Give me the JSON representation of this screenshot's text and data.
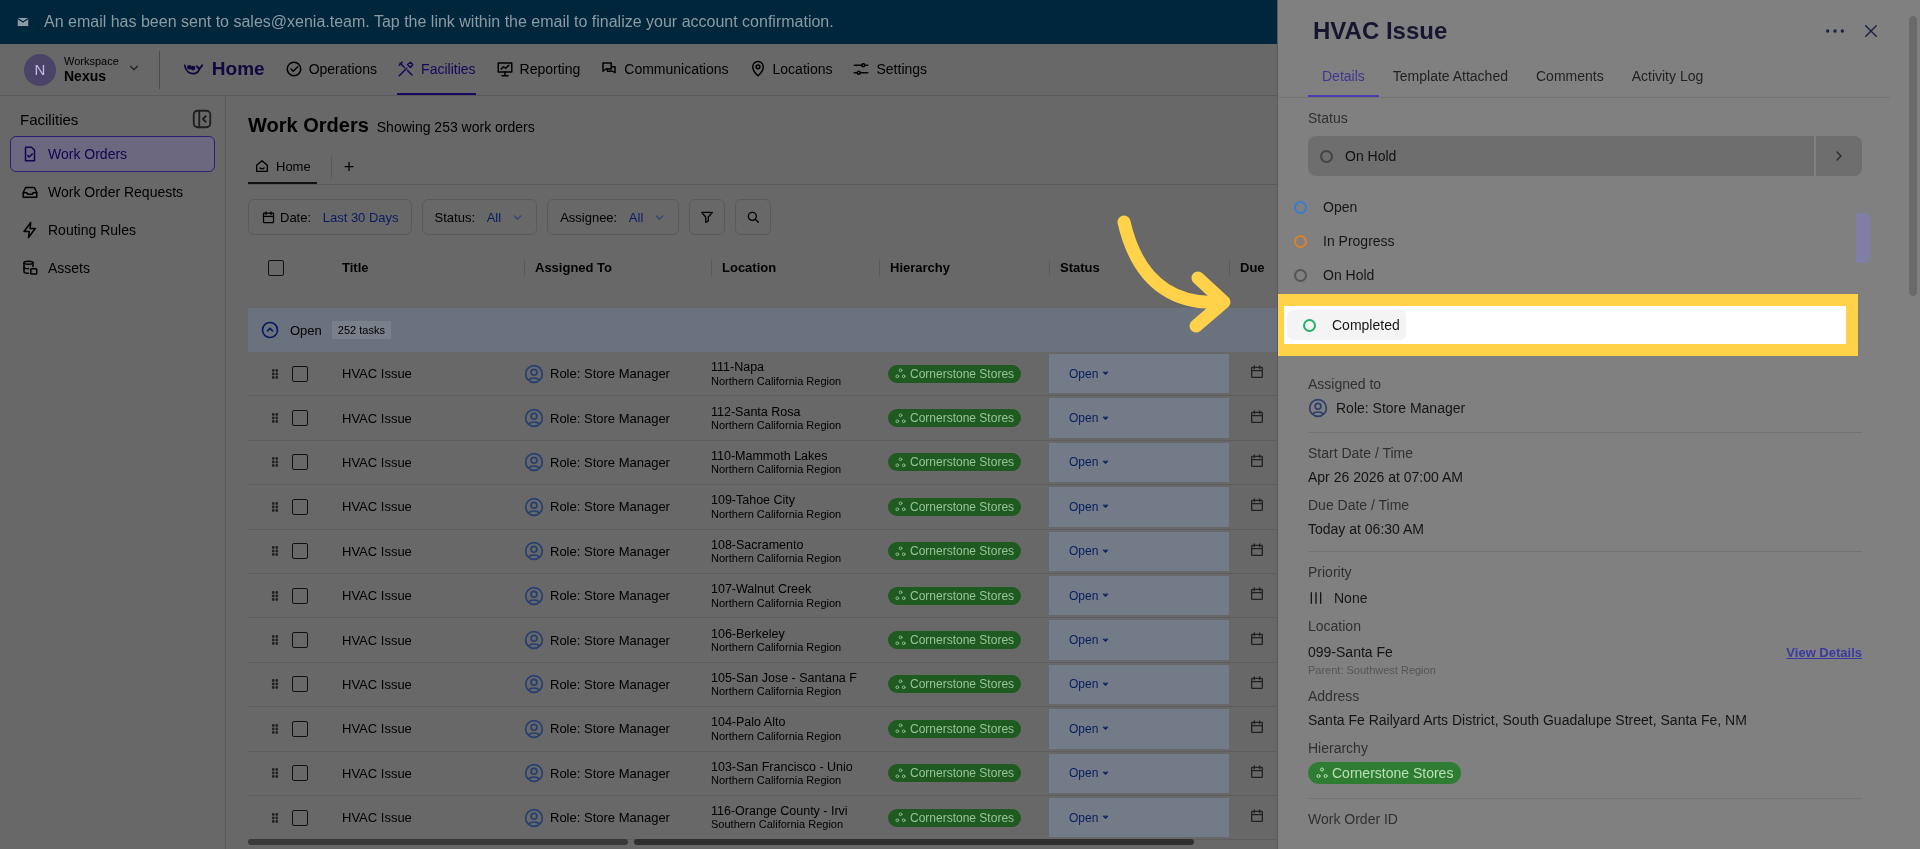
{
  "banner": {
    "message": "An email has been sent to sales@xenia.team. Tap the link within the email to finalize your account confirmation."
  },
  "workspace": {
    "avatar": "N",
    "label": "Workspace",
    "name": "Nexus"
  },
  "nav": [
    {
      "label": "Home",
      "kind": "logo",
      "selected": false
    },
    {
      "label": "Operations",
      "kind": "check",
      "selected": false
    },
    {
      "label": "Facilities",
      "kind": "tools",
      "selected": true
    },
    {
      "label": "Reporting",
      "kind": "board",
      "selected": false
    },
    {
      "label": "Communications",
      "kind": "chat",
      "selected": false
    },
    {
      "label": "Locations",
      "kind": "pin",
      "selected": false
    },
    {
      "label": "Settings",
      "kind": "sliders",
      "selected": false
    }
  ],
  "sidebar": {
    "title": "Facilities",
    "items": [
      {
        "label": "Work Orders",
        "kind": "doc",
        "selected": true
      },
      {
        "label": "Work Order Requests",
        "kind": "tray",
        "selected": false
      },
      {
        "label": "Routing Rules",
        "kind": "bolt",
        "selected": false
      },
      {
        "label": "Assets",
        "kind": "stack",
        "selected": false
      }
    ]
  },
  "page": {
    "title": "Work Orders",
    "subtitle": "Showing 253 work orders",
    "views": [
      {
        "label": "Home",
        "selected": true
      }
    ],
    "add": "+"
  },
  "filters": [
    {
      "label": "Date:",
      "value": "Last 30 Days",
      "kind": "date"
    },
    {
      "label": "Status:",
      "value": "All",
      "kind": "select"
    },
    {
      "label": "Assignee:",
      "value": "All",
      "kind": "select"
    }
  ],
  "table": {
    "select_all": {
      "checked": false
    },
    "columns": [
      "Title",
      "Assigned To",
      "Location",
      "Hierarchy",
      "Status",
      "Due"
    ],
    "group": {
      "label": "Open",
      "count": "252 tasks",
      "expanded": true
    },
    "rows": [
      {
        "checked": false,
        "title": "HVAC Issue",
        "assignee": "Role: Store Manager",
        "location": "111-Napa",
        "region": "Northern California Region",
        "hierarchy": "Cornerstone Stores",
        "status": "Open"
      },
      {
        "checked": false,
        "title": "HVAC Issue",
        "assignee": "Role: Store Manager",
        "location": "112-Santa Rosa",
        "region": "Northern California Region",
        "hierarchy": "Cornerstone Stores",
        "status": "Open"
      },
      {
        "checked": false,
        "title": "HVAC Issue",
        "assignee": "Role: Store Manager",
        "location": "110-Mammoth Lakes",
        "region": "Northern California Region",
        "hierarchy": "Cornerstone Stores",
        "status": "Open"
      },
      {
        "checked": false,
        "title": "HVAC Issue",
        "assignee": "Role: Store Manager",
        "location": "109-Tahoe City",
        "region": "Northern California Region",
        "hierarchy": "Cornerstone Stores",
        "status": "Open"
      },
      {
        "checked": false,
        "title": "HVAC Issue",
        "assignee": "Role: Store Manager",
        "location": "108-Sacramento",
        "region": "Northern California Region",
        "hierarchy": "Cornerstone Stores",
        "status": "Open"
      },
      {
        "checked": false,
        "title": "HVAC Issue",
        "assignee": "Role: Store Manager",
        "location": "107-Walnut Creek",
        "region": "Northern California Region",
        "hierarchy": "Cornerstone Stores",
        "status": "Open"
      },
      {
        "checked": false,
        "title": "HVAC Issue",
        "assignee": "Role: Store Manager",
        "location": "106-Berkeley",
        "region": "Northern California Region",
        "hierarchy": "Cornerstone Stores",
        "status": "Open"
      },
      {
        "checked": false,
        "title": "HVAC Issue",
        "assignee": "Role: Store Manager",
        "location": "105-San Jose - Santana F",
        "region": "Northern California Region",
        "hierarchy": "Cornerstone Stores",
        "status": "Open"
      },
      {
        "checked": false,
        "title": "HVAC Issue",
        "assignee": "Role: Store Manager",
        "location": "104-Palo Alto",
        "region": "Northern California Region",
        "hierarchy": "Cornerstone Stores",
        "status": "Open"
      },
      {
        "checked": false,
        "title": "HVAC Issue",
        "assignee": "Role: Store Manager",
        "location": "103-San Francisco - Unio",
        "region": "Northern California Region",
        "hierarchy": "Cornerstone Stores",
        "status": "Open"
      },
      {
        "checked": false,
        "title": "HVAC Issue",
        "assignee": "Role: Store Manager",
        "location": "116-Orange County - Irvi",
        "region": "Southern California Region",
        "hierarchy": "Cornerstone Stores",
        "status": "Open"
      }
    ]
  },
  "panel": {
    "title": "HVAC Issue",
    "tabs": [
      {
        "label": "Details",
        "selected": true
      },
      {
        "label": "Template Attached",
        "selected": false
      },
      {
        "label": "Comments",
        "selected": false
      },
      {
        "label": "Activity Log",
        "selected": false
      }
    ],
    "status": {
      "label": "Status",
      "value": "On Hold"
    },
    "status_options": [
      {
        "label": "Open",
        "color": "#3a7bd5",
        "highlighted": false
      },
      {
        "label": "In Progress",
        "color": "#d9822b",
        "highlighted": false
      },
      {
        "label": "On Hold",
        "color": "#555555",
        "highlighted": false
      },
      {
        "label": "Completed",
        "color": "#1fb36b",
        "highlighted": true
      }
    ],
    "assigned_to": {
      "label": "Assigned to",
      "value": "Role: Store Manager"
    },
    "start": {
      "label": "Start Date / Time",
      "value": "Apr 26 2026 at 07:00 AM"
    },
    "due": {
      "label": "Due Date / Time",
      "value": "Today at 06:30 AM"
    },
    "priority": {
      "label": "Priority",
      "value": "None"
    },
    "location": {
      "label": "Location",
      "name": "099-Santa Fe",
      "parent": "Parent: Southwest Region",
      "link": "View Details"
    },
    "address": {
      "label": "Address",
      "value": "Santa Fe Railyard Arts District, South Guadalupe Street, Santa Fe, NM"
    },
    "hierarchy": {
      "label": "Hierarchy",
      "value": "Cornerstone Stores"
    },
    "work_order_id": {
      "label": "Work Order ID"
    }
  }
}
